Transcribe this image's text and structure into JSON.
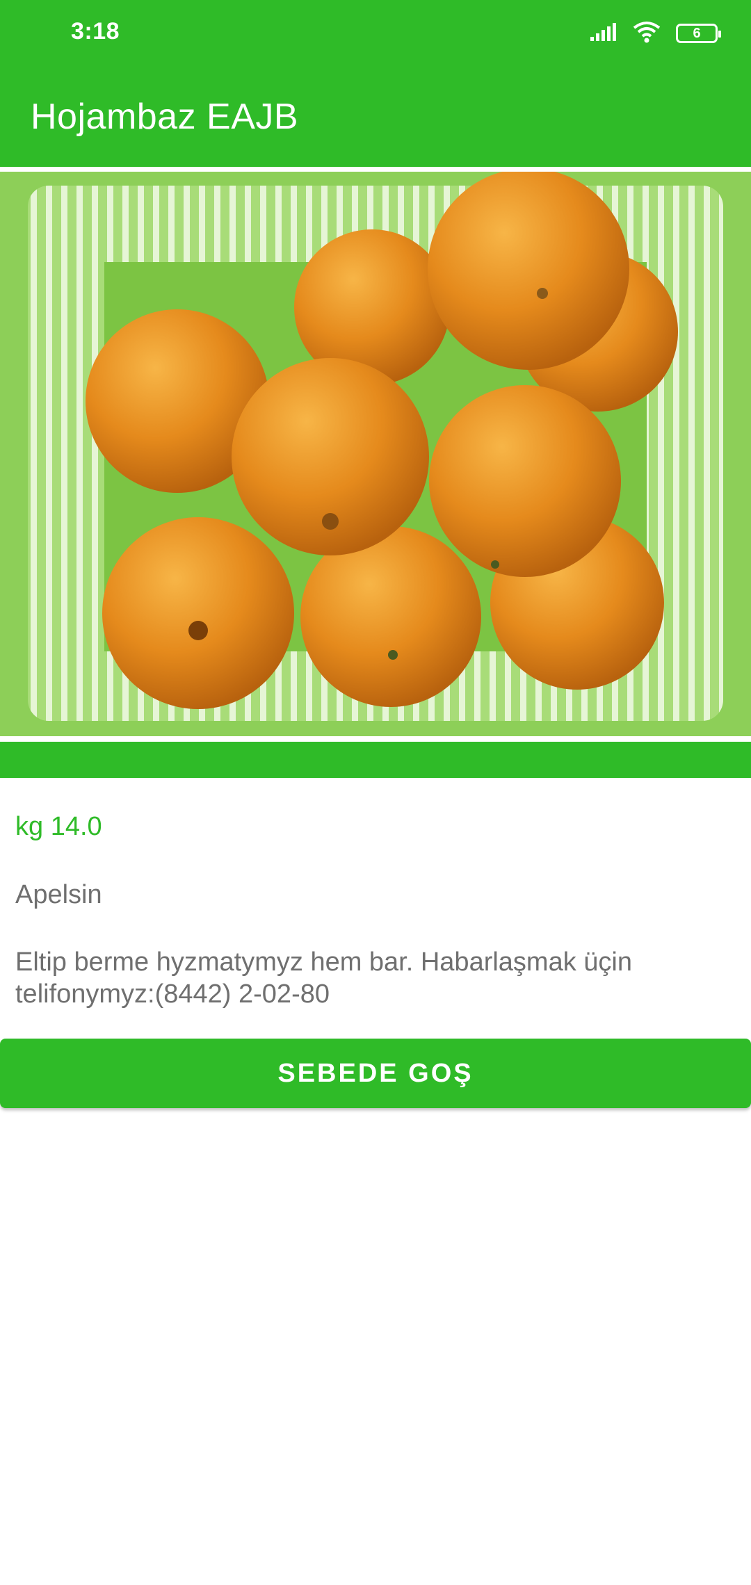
{
  "status_bar": {
    "time": "3:18",
    "battery_level": "6",
    "icons": [
      "signal-icon",
      "wifi-icon",
      "battery-icon"
    ]
  },
  "app_bar": {
    "title": "Hojambaz EAJB",
    "color": "#2fbb28"
  },
  "product": {
    "image": "oranges-in-basket",
    "price": "kg 14.0",
    "name": "Apelsin",
    "description": "Eltip berme hyzmatymyz hem bar. Habarlaşmak üçin telifonymyz:(8442) 2-02-80"
  },
  "actions": {
    "add_to_cart_label": "SEBEDE GOŞ"
  }
}
